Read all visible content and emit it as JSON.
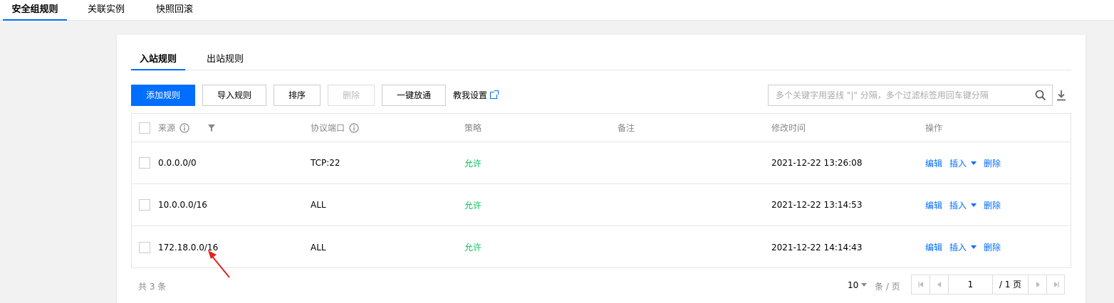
{
  "top_tabs": [
    "安全组规则",
    "关联实例",
    "快照回滚"
  ],
  "sub_tabs": [
    "入站规则",
    "出站规则"
  ],
  "toolbar": {
    "add": "添加规则",
    "import": "导入规则",
    "sort": "排序",
    "delete": "删除",
    "open_all": "一键放通",
    "help": "教我设置"
  },
  "search": {
    "placeholder": "多个关键字用竖线 \"|\" 分隔，多个过滤标签用回车键分隔"
  },
  "table": {
    "headers": {
      "source": "来源",
      "protocol_port": "协议端口",
      "policy": "策略",
      "note": "备注",
      "modified_time": "修改时间",
      "actions": "操作"
    },
    "rows": [
      {
        "source": "0.0.0.0/0",
        "protocol_port": "TCP:22",
        "policy": "允许",
        "note": "",
        "modified_time": "2021-12-22 13:26:08"
      },
      {
        "source": "10.0.0.0/16",
        "protocol_port": "ALL",
        "policy": "允许",
        "note": "",
        "modified_time": "2021-12-22 13:14:53"
      },
      {
        "source": "172.18.0.0/16",
        "protocol_port": "ALL",
        "policy": "允许",
        "note": "",
        "modified_time": "2021-12-22 14:14:43"
      }
    ],
    "actions": {
      "edit": "编辑",
      "insert": "插入",
      "delete": "删除"
    }
  },
  "footer": {
    "total": "共 3 条",
    "page_size": "10",
    "per_page": "条 / 页",
    "current_page": "1",
    "total_pages": "/ 1 页"
  },
  "colors": {
    "primary": "#006eff",
    "allow": "#0abf5b",
    "annotation": "#e5211b"
  }
}
